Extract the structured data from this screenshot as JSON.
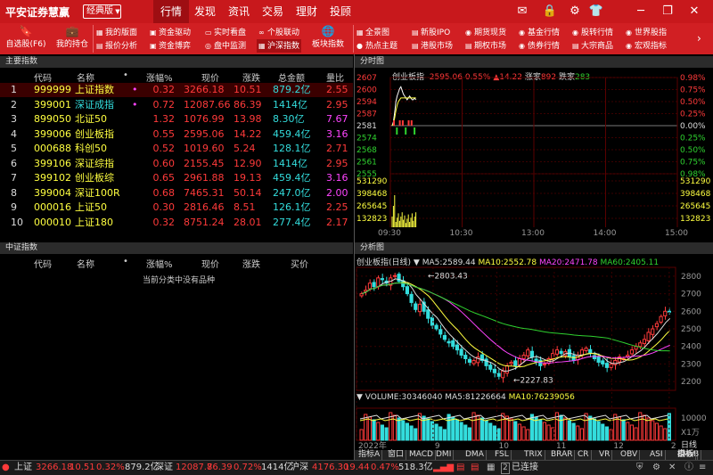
{
  "app": {
    "title": "平安证券慧赢",
    "version": "经典版"
  },
  "menu": [
    "行情",
    "发现",
    "资讯",
    "交易",
    "理财",
    "投顾"
  ],
  "window_icons": [
    "mail-icon",
    "lock-icon",
    "gear-icon",
    "shirt-icon",
    "minimize-icon",
    "restore-icon",
    "close-icon"
  ],
  "toolbar": {
    "self_select": "自选股(F6)",
    "holdings": "我的持仓",
    "plates": "板块指数",
    "col1": [
      "我的版面",
      "报价分析"
    ],
    "col2": [
      "资金驱动",
      "资金博弈"
    ],
    "col3": [
      "实时看盘",
      "盘中监测"
    ],
    "col4": [
      "个股联动",
      "沪深指数"
    ],
    "col5": [
      "全景图",
      "热点主题"
    ],
    "col6": [
      "新股IPO",
      "港股市场"
    ],
    "col7": [
      "期货现货",
      "期权市场"
    ],
    "col8": [
      "基金行情",
      "债券行情"
    ],
    "col9": [
      "股转行情",
      "大宗商品"
    ],
    "col10": [
      "世界股指",
      "宏观指标"
    ]
  },
  "main_index": {
    "panel_title": "主要指数",
    "columns": [
      "代码",
      "名称",
      "•",
      "涨幅%",
      "现价",
      "涨跌",
      "总金额",
      "量比"
    ],
    "rows": [
      {
        "n": "1",
        "code": "999999",
        "name": "上证指数",
        "mark": "•",
        "pct": "0.32",
        "price": "3266.18",
        "chg": "10.51",
        "amt": "879.2亿",
        "vr": "2.55"
      },
      {
        "n": "2",
        "code": "399001",
        "name": "深证成指",
        "mark": "•",
        "pct": "0.72",
        "price": "12087.66",
        "chg": "86.39",
        "amt": "1414亿",
        "vr": "2.95"
      },
      {
        "n": "3",
        "code": "899050",
        "name": "北证50",
        "mark": "",
        "pct": "1.32",
        "price": "1076.99",
        "chg": "13.98",
        "amt": "8.30亿",
        "vr": "7.67"
      },
      {
        "n": "4",
        "code": "399006",
        "name": "创业板指",
        "mark": "",
        "pct": "0.55",
        "price": "2595.06",
        "chg": "14.22",
        "amt": "459.4亿",
        "vr": "3.16"
      },
      {
        "n": "5",
        "code": "000688",
        "name": "科创50",
        "mark": "",
        "pct": "0.52",
        "price": "1019.60",
        "chg": "5.24",
        "amt": "128.1亿",
        "vr": "2.71"
      },
      {
        "n": "6",
        "code": "399106",
        "name": "深证综指",
        "mark": "",
        "pct": "0.60",
        "price": "2155.45",
        "chg": "12.90",
        "amt": "1414亿",
        "vr": "2.95"
      },
      {
        "n": "7",
        "code": "399102",
        "name": "创业板综",
        "mark": "",
        "pct": "0.65",
        "price": "2961.88",
        "chg": "19.13",
        "amt": "459.4亿",
        "vr": "3.16"
      },
      {
        "n": "8",
        "code": "399004",
        "name": "深证100R",
        "mark": "",
        "pct": "0.68",
        "price": "7465.31",
        "chg": "50.14",
        "amt": "247.0亿",
        "vr": "2.00"
      },
      {
        "n": "9",
        "code": "000016",
        "name": "上证50",
        "mark": "",
        "pct": "0.30",
        "price": "2816.46",
        "chg": "8.51",
        "amt": "126.1亿",
        "vr": "2.25"
      },
      {
        "n": "10",
        "code": "000010",
        "name": "上证180",
        "mark": "",
        "pct": "0.32",
        "price": "8751.24",
        "chg": "28.01",
        "amt": "277.4亿",
        "vr": "2.17"
      }
    ]
  },
  "zz_index": {
    "panel_title": "中证指数",
    "columns": [
      "代码",
      "名称",
      "•",
      "涨幅%",
      "现价",
      "涨跌",
      "买价"
    ],
    "empty": "当前分类中没有品种"
  },
  "timeshare": {
    "panel_title": "分时图",
    "name": "创业板指",
    "price": "2595.06",
    "pct": "0.55%",
    "chg": "▲14.22",
    "up_label": "涨家",
    "up": "892",
    "down_label": "跌家",
    "down": "283",
    "y_left": [
      "2607",
      "2600",
      "2594",
      "2587",
      "2581",
      "2574",
      "2568",
      "2561",
      "2555"
    ],
    "y_right": [
      "0.98%",
      "0.75%",
      "0.50%",
      "0.25%",
      "0.00%",
      "0.25%",
      "0.50%",
      "0.75%",
      "0.98%"
    ],
    "vol_left": [
      "531290",
      "398468",
      "265645",
      "132823"
    ],
    "vol_right": [
      "531290",
      "398468",
      "265645",
      "132823"
    ],
    "x_ticks": [
      "09:30",
      "10:30",
      "13:00",
      "14:00",
      "15:00"
    ],
    "price_series": [
      2581,
      2583,
      2588,
      2594,
      2597,
      2599,
      2601,
      2602,
      2600,
      2598,
      2597,
      2596,
      2595,
      2596,
      2597,
      2596,
      2595,
      2595,
      2596,
      2595
    ],
    "avg_series": [
      2581,
      2582,
      2585,
      2589,
      2592,
      2594,
      2595,
      2596,
      2596,
      2596,
      2596,
      2596,
      2596,
      2596,
      2596,
      2596,
      2596,
      2596,
      2596,
      2596
    ]
  },
  "kline": {
    "panel_title": "分析图",
    "name": "创业板指(日线)",
    "ma5_label": "MA5:",
    "ma5": "2589.44",
    "ma10_label": "MA10:",
    "ma10": "2552.78",
    "ma20_label": "MA20:",
    "ma20": "2471.78",
    "ma60_label": "MA60:",
    "ma60": "2405.11",
    "high_label": "2803.43",
    "low_label": "2227.83",
    "y_ticks": [
      "2800",
      "2700",
      "2600",
      "2500",
      "2400",
      "2300",
      "2200"
    ],
    "vol_title": "VOLUME:",
    "vol": "30346040",
    "vol_ma5_label": "MA5:",
    "vol_ma5": "81226664",
    "vol_ma10_label": "MA10:",
    "vol_ma10": "76239056",
    "vol_ticks": [
      "10000",
      "X1万"
    ],
    "x_ticks": [
      "2022年",
      "9",
      "10",
      "11",
      "12",
      "2"
    ],
    "period": "日线",
    "closes": [
      2700,
      2720,
      2760,
      2740,
      2790,
      2780,
      2760,
      2790,
      2803,
      2770,
      2740,
      2700,
      2650,
      2610,
      2640,
      2600,
      2560,
      2520,
      2500,
      2470,
      2440,
      2420,
      2400,
      2380,
      2350,
      2330,
      2310,
      2320,
      2340,
      2320,
      2290,
      2270,
      2250,
      2230,
      2260,
      2290,
      2310,
      2290,
      2330,
      2350,
      2380,
      2340,
      2310,
      2290,
      2300,
      2330,
      2360,
      2380,
      2360,
      2370,
      2340,
      2320,
      2350,
      2380,
      2390,
      2360,
      2330,
      2310,
      2300,
      2280,
      2300,
      2320,
      2340,
      2330,
      2350,
      2380,
      2400,
      2420,
      2440,
      2480,
      2500,
      2530,
      2570,
      2600,
      2595
    ]
  },
  "indicator_tabs": [
    "指标A",
    "窗口",
    "MACD",
    "DMI",
    "DMA",
    "FSL",
    "TRIX",
    "BRAR",
    "CR",
    "VR",
    "OBV",
    "ASI",
    "EMV",
    "指标B",
    "模板"
  ],
  "status": {
    "sh_label": "上证",
    "sh_price": "3266.18",
    "sh_chg": "10.51",
    "sh_pct": "0.32%",
    "sh_amt": "879.2亿",
    "sz_label": "深证",
    "sz_price": "12087.7",
    "sz_chg": "86.39",
    "sz_pct": "0.72%",
    "sz_amt": "1414亿",
    "hs_label": "沪深",
    "hs_price": "4176.30",
    "hs_chg": "19.44",
    "hs_pct": "0.47%",
    "hs_amt": "518.3亿",
    "conn": "已连接"
  }
}
